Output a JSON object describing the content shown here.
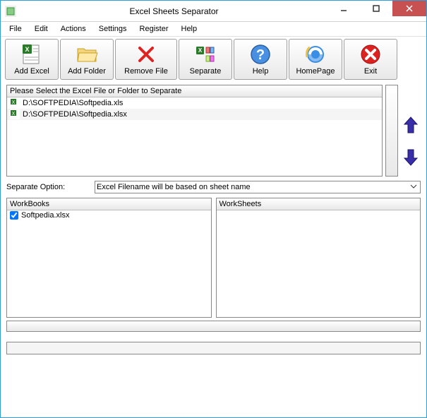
{
  "window": {
    "title": "Excel Sheets Separator"
  },
  "menu": {
    "file": "File",
    "edit": "Edit",
    "actions": "Actions",
    "settings": "Settings",
    "register": "Register",
    "help": "Help"
  },
  "toolbar": {
    "add_excel": "Add Excel",
    "add_folder": "Add Folder",
    "remove_file": "Remove File",
    "separate": "Separate",
    "help": "Help",
    "homepage": "HomePage",
    "exit": "Exit"
  },
  "file_list": {
    "header": "Please Select the Excel File or Folder to Separate",
    "items": [
      "D:\\SOFTPEDIA\\Softpedia.xls",
      "D:\\SOFTPEDIA\\Softpedia.xlsx"
    ]
  },
  "option": {
    "label": "Separate Option:",
    "selected": "Excel Filename will be based on sheet name"
  },
  "panels": {
    "workbooks_header": "WorkBooks",
    "worksheets_header": "WorkSheets",
    "workbooks": [
      {
        "checked": true,
        "name": "Softpedia.xlsx"
      }
    ]
  }
}
